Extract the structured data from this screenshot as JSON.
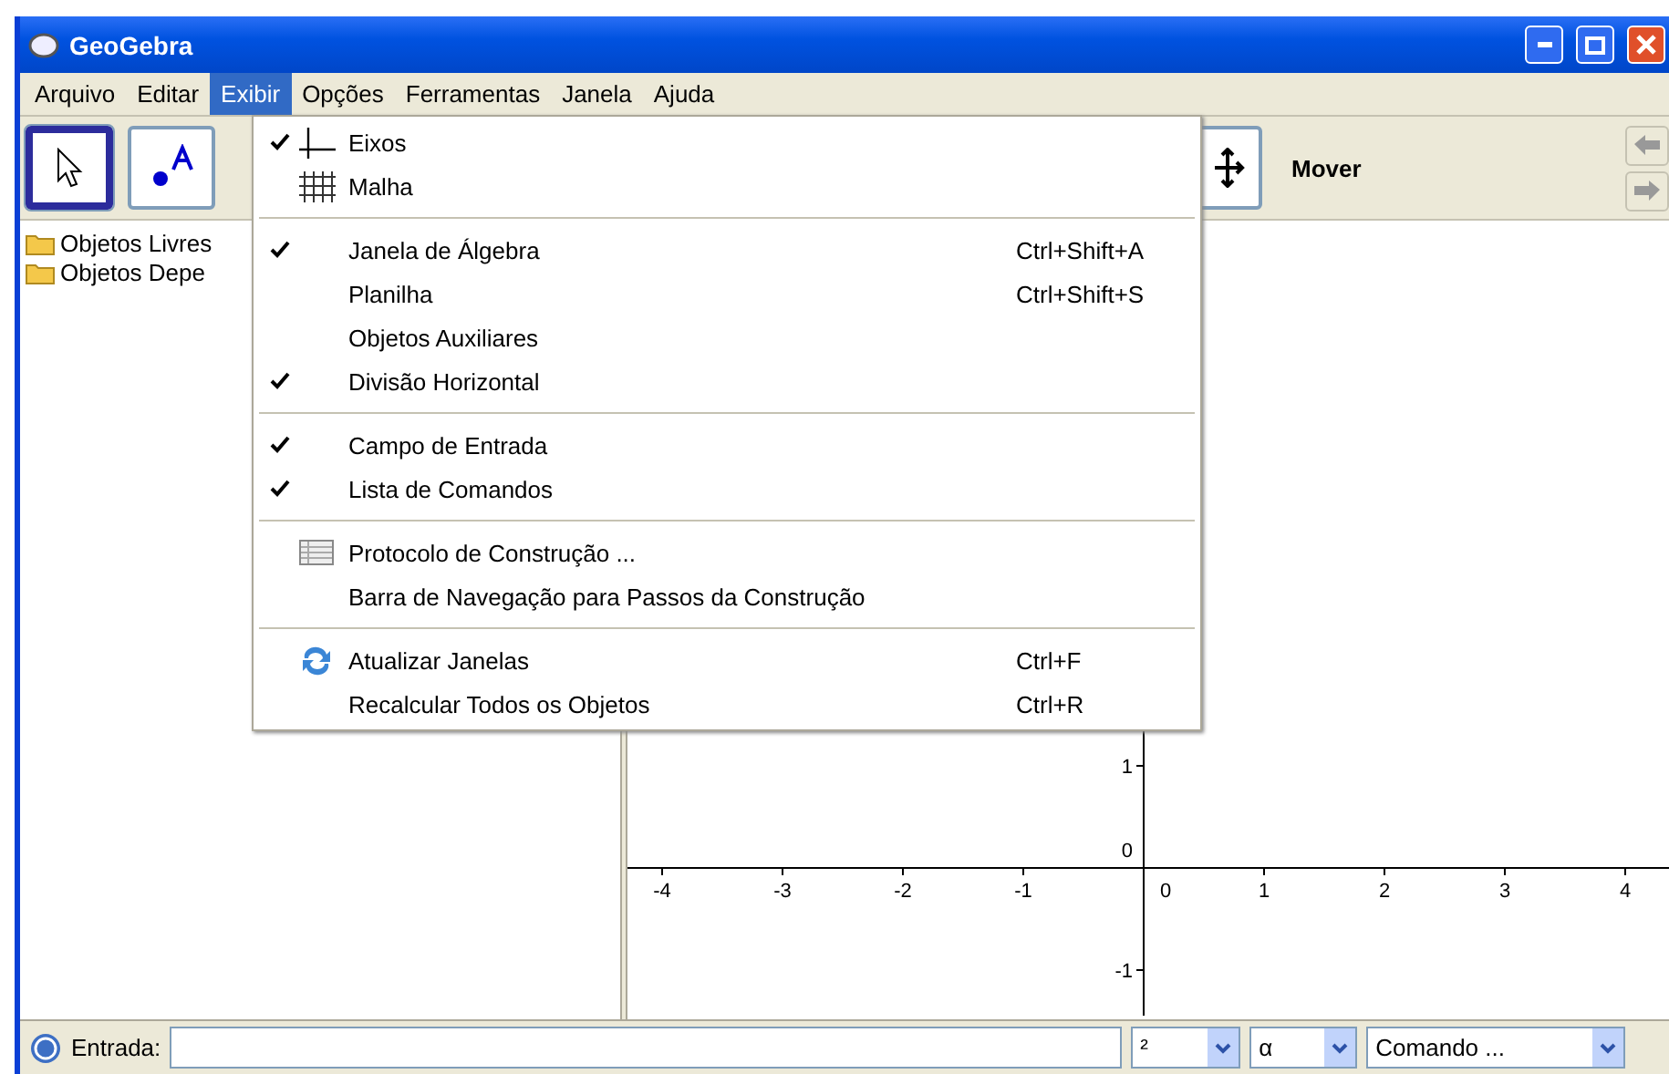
{
  "window": {
    "title": "GeoGebra"
  },
  "menubar": [
    {
      "label": "Arquivo",
      "selected": false
    },
    {
      "label": "Editar",
      "selected": false
    },
    {
      "label": "Exibir",
      "selected": true
    },
    {
      "label": "Opções",
      "selected": false
    },
    {
      "label": "Ferramentas",
      "selected": false
    },
    {
      "label": "Janela",
      "selected": false
    },
    {
      "label": "Ajuda",
      "selected": false
    }
  ],
  "toolbar": {
    "tools": [
      {
        "selected": true
      },
      {
        "selected": false
      },
      {
        "selected": false
      }
    ],
    "tool_name": "Mover"
  },
  "algebra": {
    "items": [
      {
        "label": "Objetos Livres"
      },
      {
        "label": "Objetos Depe"
      }
    ]
  },
  "graphics": {
    "x_labels": [
      "-4",
      "-3",
      "-2",
      "-1",
      "0",
      "1",
      "2",
      "3",
      "4"
    ],
    "y_labels": [
      "1",
      "0",
      "-1"
    ]
  },
  "menu": {
    "groups": [
      [
        {
          "label": "Eixos",
          "checked": true
        },
        {
          "label": "Malha",
          "checked": false
        }
      ],
      [
        {
          "label": "Janela de Álgebra",
          "checked": true,
          "shortcut": "Ctrl+Shift+A"
        },
        {
          "label": "Planilha",
          "checked": false,
          "shortcut": "Ctrl+Shift+S"
        },
        {
          "label": "Objetos Auxiliares",
          "checked": false
        },
        {
          "label": "Divisão Horizontal",
          "checked": true
        }
      ],
      [
        {
          "label": "Campo de Entrada",
          "checked": true
        },
        {
          "label": "Lista de Comandos",
          "checked": true
        }
      ],
      [
        {
          "label": "Protocolo de Construção ...",
          "checked": false
        },
        {
          "label": "Barra de Navegação para Passos da Construção",
          "checked": false
        }
      ],
      [
        {
          "label": "Atualizar Janelas",
          "checked": false,
          "shortcut": "Ctrl+F"
        },
        {
          "label": "Recalcular Todos os Objetos",
          "checked": false,
          "shortcut": "Ctrl+R"
        }
      ]
    ]
  },
  "input_bar": {
    "label": "Entrada:",
    "dropdowns": [
      "²",
      "α",
      "Comando ..."
    ]
  }
}
